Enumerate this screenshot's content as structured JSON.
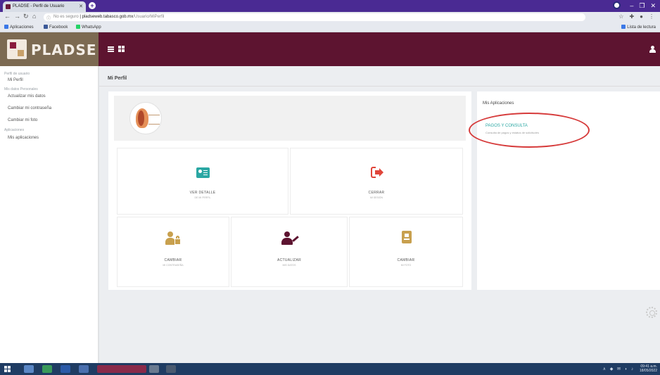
{
  "browser": {
    "tab_title": "PLADSE - Perfil de Usuario",
    "new_tab": "+",
    "window_controls": [
      "–",
      "❐",
      "✕"
    ],
    "url_prefix": "No es seguro",
    "url": "pladseweb.tabasco.gob.mx",
    "url_path": "/Usuario/MiPerfil",
    "bookmarks": [
      {
        "label": "Aplicaciones",
        "color": "#3b78e7"
      },
      {
        "label": "Facebook",
        "color": "#3b5998"
      },
      {
        "label": "WhatsApp",
        "color": "#25d366"
      }
    ],
    "bookmarks_right": "Lista de lectura"
  },
  "app": {
    "logo_text": "PLADSE",
    "colors": {
      "brand": "#5d1430",
      "brand_side": "#7c6a52",
      "accent": "#2aa7a3",
      "gold": "#c8a04e",
      "danger": "#e0453a"
    }
  },
  "sidebar": {
    "sections": [
      {
        "title": "Perfil de usuario",
        "items": [
          "Mi Perfil"
        ]
      },
      {
        "title": "Mis datos Personales",
        "items": [
          "Actualizar mis datos",
          "Cambiar mi contraseña",
          "Cambiar mi foto"
        ]
      },
      {
        "title": "Aplicaciones",
        "items": [
          "Mis aplicaciones"
        ]
      }
    ]
  },
  "main": {
    "page_title": "Mi Perfil",
    "tiles": [
      {
        "label": "VER DETALLE",
        "sub": "DE MI PERFIL",
        "icon": "id-card-icon"
      },
      {
        "label": "CERRAR",
        "sub": "MI SESIÓN",
        "icon": "sign-out-icon"
      },
      {
        "label": "CAMBIAR",
        "sub": "MI CONTRASEÑA",
        "icon": "user-lock-icon"
      },
      {
        "label": "ACTUALIZAR",
        "sub": "MIS DATOS",
        "icon": "user-edit-icon"
      },
      {
        "label": "CAMBIAR",
        "sub": "MI FOTO",
        "icon": "id-badge-icon"
      }
    ],
    "apps_panel": {
      "title": "Mis Aplicaciones",
      "app_name": "PAGOS Y CONSULTA",
      "app_desc": "Consulta de pagos y estatus de solicitudes"
    }
  },
  "taskbar": {
    "tray": "∧ ◆ ✉ ◗ ♪",
    "time": "09:41 a.m.",
    "date": "18/05/2022"
  }
}
